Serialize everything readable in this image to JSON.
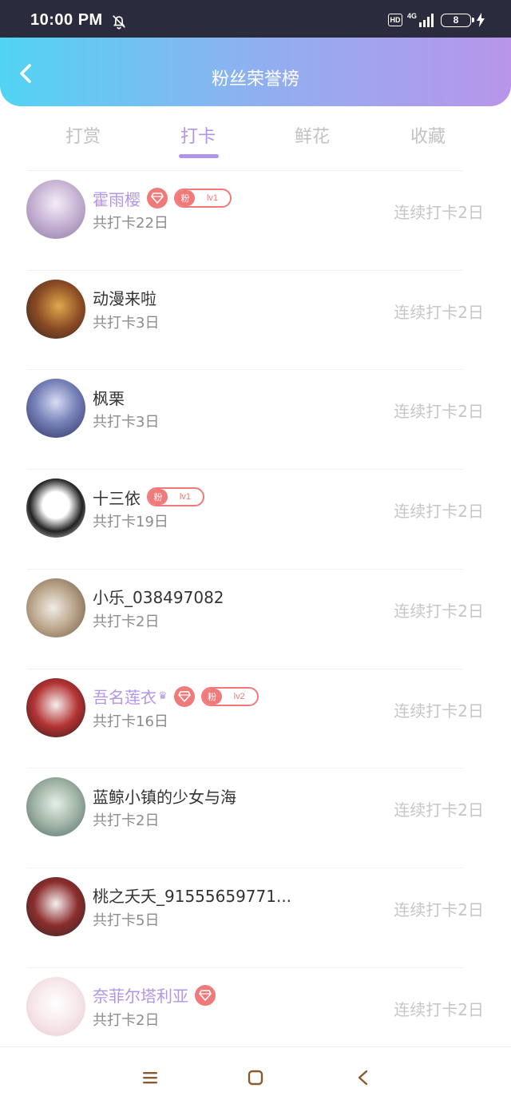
{
  "status_bar": {
    "time": "10:00 PM",
    "hd": "HD",
    "network": "4G",
    "battery": "8",
    "icons": [
      "mute-bell-icon",
      "signal-icon",
      "battery-icon",
      "charging-icon"
    ]
  },
  "header": {
    "title": "粉丝荣誉榜",
    "back_icon": "chevron-left-icon"
  },
  "tabs": [
    {
      "label": "打赏",
      "active": false
    },
    {
      "label": "打卡",
      "active": true
    },
    {
      "label": "鲜花",
      "active": false
    },
    {
      "label": "收藏",
      "active": false
    }
  ],
  "colors": {
    "accent": "#b295e6",
    "badge": "#f07a7a",
    "header_gradient": [
      "#52d4f3",
      "#b895ea"
    ]
  },
  "rows": [
    {
      "name": "霍雨樱",
      "total": "共打卡22日",
      "streak": "连续打卡2日",
      "vip": true,
      "gem": true,
      "fan_badge": {
        "fen": "粉",
        "level": "lv1"
      }
    },
    {
      "name": "动漫来啦",
      "total": "共打卡3日",
      "streak": "连续打卡2日"
    },
    {
      "name": "枫栗",
      "total": "共打卡3日",
      "streak": "连续打卡2日"
    },
    {
      "name": "十三依",
      "total": "共打卡19日",
      "streak": "连续打卡2日",
      "fan_badge": {
        "fen": "粉",
        "level": "lv1"
      }
    },
    {
      "name": "小乐_038497082",
      "total": "共打卡2日",
      "streak": "连续打卡2日"
    },
    {
      "name": "吾名莲衣",
      "total": "共打卡16日",
      "streak": "连续打卡2日",
      "vip": true,
      "crown": "♛",
      "gem": true,
      "fan_badge": {
        "fen": "粉",
        "level": "lv2"
      }
    },
    {
      "name": "蓝鲸小镇的少女与海",
      "total": "共打卡2日",
      "streak": "连续打卡2日"
    },
    {
      "name": "桃之夭夭_91555659771...",
      "total": "共打卡5日",
      "streak": "连续打卡2日"
    },
    {
      "name": "奈菲尔塔利亚",
      "total": "共打卡2日",
      "streak": "连续打卡2日",
      "vip": true,
      "gem": true
    }
  ],
  "nav_bar": {
    "icons": [
      "menu-icon",
      "home-square-icon",
      "back-triangle-icon"
    ]
  }
}
